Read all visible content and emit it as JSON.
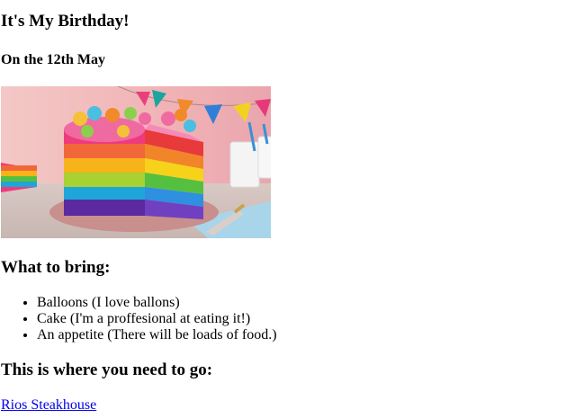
{
  "page": {
    "title": "It's My Birthday!",
    "date": "On the 12th May"
  },
  "image": {
    "subject": "rainbow-layer-cake-photo"
  },
  "bring": {
    "heading": "What to bring:",
    "items": [
      "Balloons (I love ballons)",
      "Cake (I'm a proffesional at eating it!)",
      "An appetite (There will be loads of food.)"
    ]
  },
  "location": {
    "heading": "This is where you need to go:",
    "link_text": "Rios Steakhouse"
  },
  "colors": {
    "link": "#0000ee",
    "text": "#000000",
    "background": "#ffffff"
  }
}
